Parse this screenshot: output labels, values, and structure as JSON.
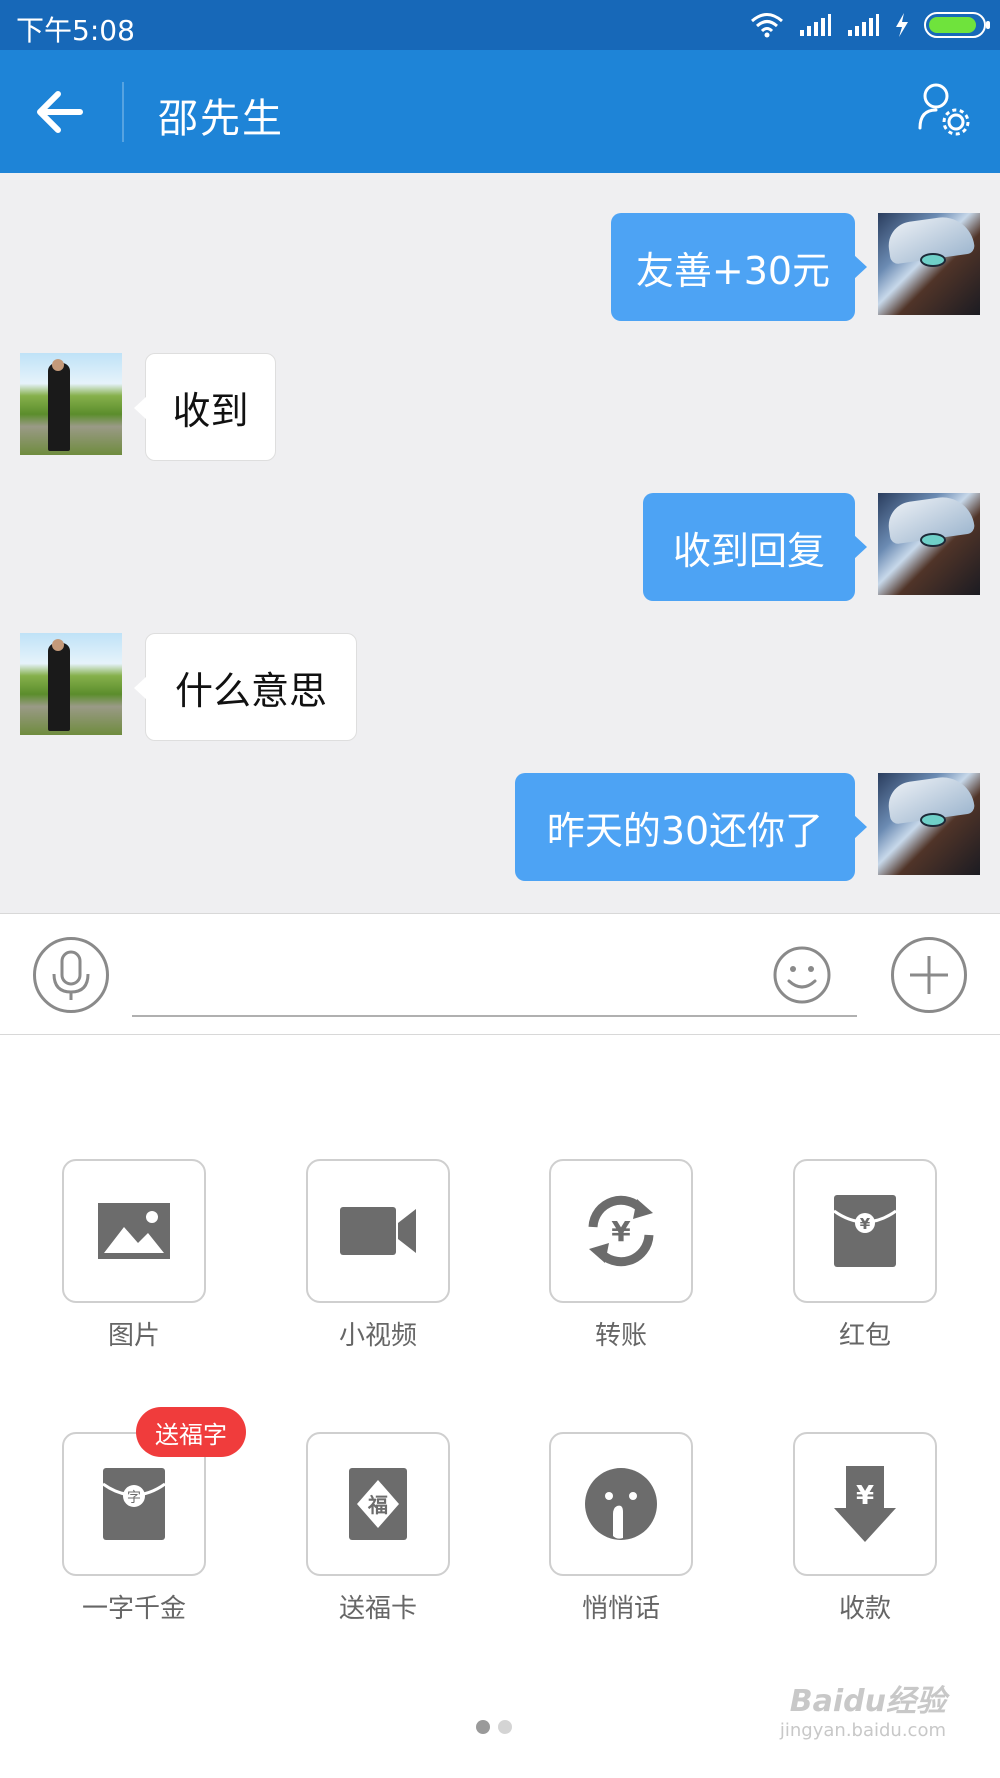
{
  "status_bar": {
    "time": "下午5:08",
    "icons": [
      "wifi-icon",
      "signal-icon",
      "signal-icon",
      "charging-icon",
      "battery-icon"
    ],
    "battery_color": "#6fe33c"
  },
  "header": {
    "contact_name": "邵先生",
    "background": "#1e84d7"
  },
  "messages": [
    {
      "from": "me",
      "text": "友善+30元"
    },
    {
      "from": "other",
      "text": "收到"
    },
    {
      "from": "me",
      "text": "收到回复"
    },
    {
      "from": "other",
      "text": "什么意思"
    },
    {
      "from": "me",
      "text": "昨天的30还你了"
    }
  ],
  "bubble_colors": {
    "outgoing": "#4da3f4",
    "incoming": "#ffffff"
  },
  "input_bar": {
    "value": "",
    "icons": [
      "microphone-icon",
      "emoji-icon",
      "plus-icon"
    ]
  },
  "panel": {
    "tools": [
      {
        "label": "图片",
        "icon": "image-icon"
      },
      {
        "label": "小视频",
        "icon": "video-camera-icon"
      },
      {
        "label": "转账",
        "icon": "transfer-icon"
      },
      {
        "label": "红包",
        "icon": "red-packet-icon"
      },
      {
        "label": "一字千金",
        "icon": "character-packet-icon"
      },
      {
        "label": "送福卡",
        "icon": "fu-card-icon"
      },
      {
        "label": "悄悄话",
        "icon": "whisper-icon"
      },
      {
        "label": "收款",
        "icon": "receive-money-icon"
      }
    ],
    "badge": "送福字",
    "page_indicator": {
      "pages": 2,
      "current": 1
    }
  },
  "watermark": {
    "brand": "Baidu经验",
    "url": "jingyan.baidu.com"
  }
}
